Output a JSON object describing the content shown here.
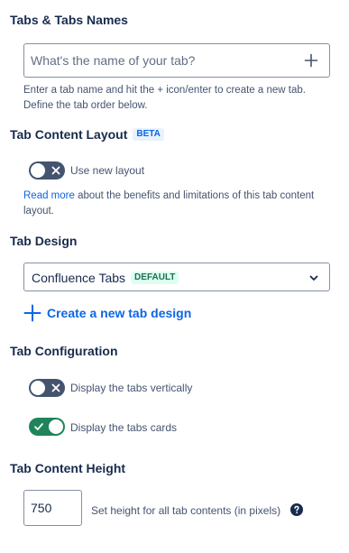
{
  "tabs_names": {
    "heading": "Tabs & Tabs Names",
    "placeholder": "What's the name of your tab?",
    "value": "",
    "helper_line1": "Enter a tab name and hit the + icon/enter to create a new tab.",
    "helper_line2": "Define the tab order below.",
    "add_icon": "plus-icon"
  },
  "content_layout": {
    "heading": "Tab Content Layout",
    "badge": "BETA",
    "toggle_label": "Use new layout",
    "toggle_on": false,
    "read_more_link": "Read more",
    "read_more_rest_line1": " about the benefits and limitations of this tab content",
    "read_more_rest_line2": "layout."
  },
  "design": {
    "heading": "Tab Design",
    "selected_value": "Confluence Tabs",
    "selected_badge": "DEFAULT",
    "create_link": "Create a new tab design"
  },
  "configuration": {
    "heading": "Tab Configuration",
    "vertical_label": "Display the tabs vertically",
    "vertical_on": false,
    "cards_label": "Display the tabs cards",
    "cards_on": true
  },
  "content_height": {
    "heading": "Tab Content Height",
    "value": "750",
    "hint": "Set height for all tab contents (in pixels)",
    "help_icon": "question-circle-icon"
  },
  "colors": {
    "text": "#172b4d",
    "subtle_text": "#44546f",
    "link": "#0c66e4",
    "toggle_off": "#44546f",
    "toggle_on": "#1f845a",
    "beta_bg": "#e9f2ff",
    "default_bg": "#dcfff1",
    "default_text": "#216e4e"
  }
}
